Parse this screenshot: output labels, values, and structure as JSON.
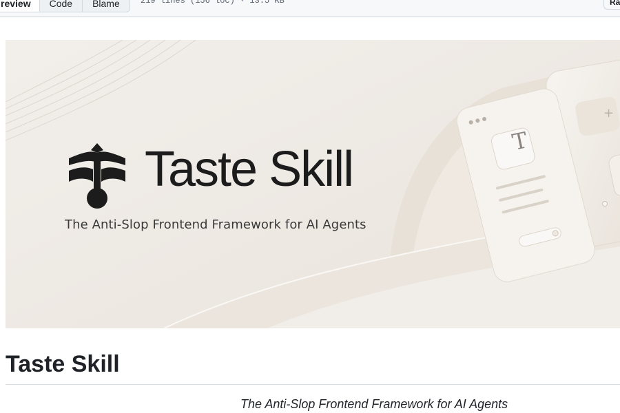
{
  "toolbar": {
    "tabs": [
      {
        "label": "review",
        "active": true
      },
      {
        "label": "Code",
        "active": false
      },
      {
        "label": "Blame",
        "active": false
      }
    ],
    "file_meta": "219 lines (156 loc) · 13.5 KB",
    "raw_label": "Raw"
  },
  "banner": {
    "brand_title": "Taste Skill",
    "tagline": "The Anti-Slop Frontend Framework for AI Agents",
    "card_letter": "T",
    "card_plus": "+"
  },
  "readme": {
    "heading": "Taste Skill",
    "subtitle": "The Anti-Slop Frontend Framework for AI Agents"
  },
  "colors": {
    "toolbar_bg": "#f6f8fa",
    "border": "#d0d7de",
    "banner_bg": "#efebe6",
    "text": "#1f2328",
    "logo": "#1c1c1c"
  }
}
